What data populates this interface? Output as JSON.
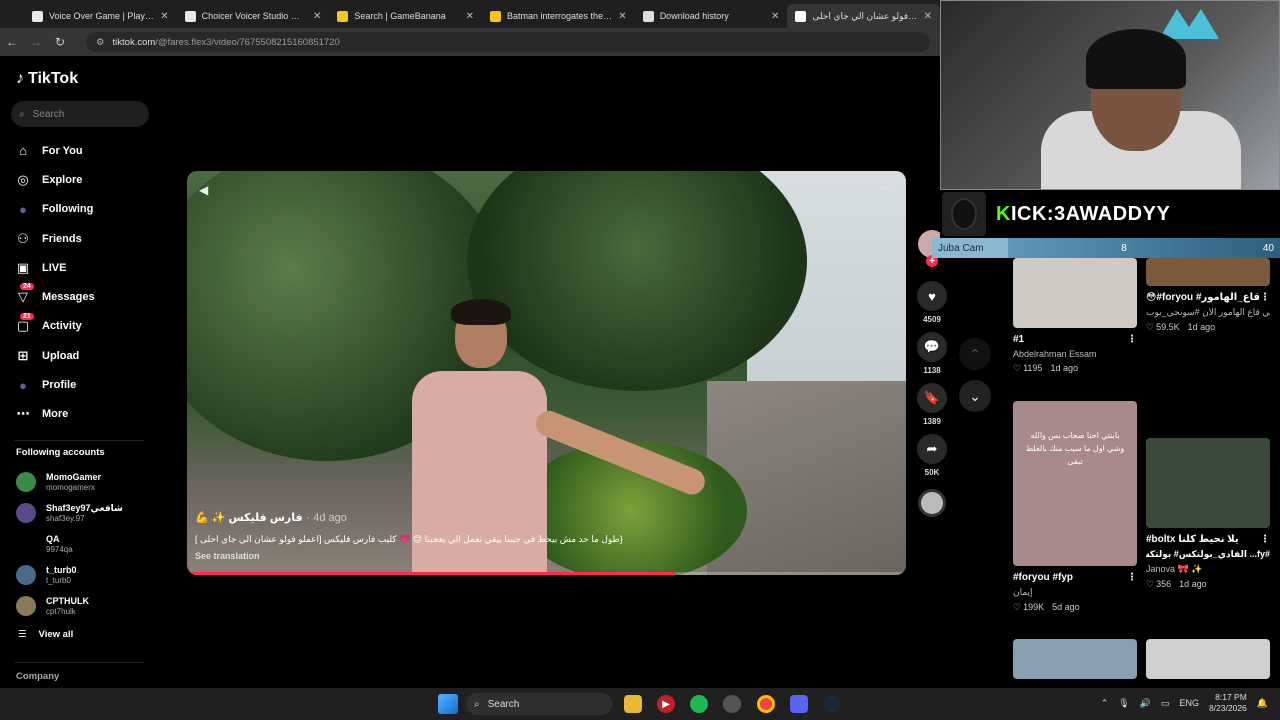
{
  "tabs": [
    {
      "title": "Voice Over Game | Play Choicer",
      "icon": "page-icon",
      "color": "#e8e8e8"
    },
    {
      "title": "Choicer Voicer Studio — Free C",
      "icon": "page-icon",
      "color": "#e8e8e8"
    },
    {
      "title": "Search | GameBanana",
      "icon": "banana-icon",
      "color": "#f5c518"
    },
    {
      "title": "Batman interrogates the Joker -",
      "icon": "banana-icon",
      "color": "#f5c518"
    },
    {
      "title": "Download history",
      "icon": "download-icon",
      "color": "#dddddd"
    },
    {
      "title": "علمو فولو عشان الي جاي احلى |",
      "icon": "tiktok-icon",
      "color": "#ffffff"
    }
  ],
  "tab_close": "✕",
  "address": {
    "host": "tiktok.com",
    "path": "/@fares.flex3/video/7675508215160851720"
  },
  "tiktok": {
    "logo": "TikTok",
    "search_placeholder": "Search",
    "menu": [
      {
        "label": "For You",
        "icon": "home-icon",
        "glyph": "⌂"
      },
      {
        "label": "Explore",
        "icon": "compass-icon",
        "glyph": "◎"
      },
      {
        "label": "Following",
        "icon": "following-avatar-icon",
        "glyph": "●"
      },
      {
        "label": "Friends",
        "icon": "friends-icon",
        "glyph": "⚇"
      },
      {
        "label": "LIVE",
        "icon": "live-icon",
        "glyph": "▣"
      },
      {
        "label": "Messages",
        "icon": "messages-icon",
        "glyph": "▽",
        "badge": "24"
      },
      {
        "label": "Activity",
        "icon": "activity-icon",
        "glyph": "▢",
        "badge": "21"
      },
      {
        "label": "Upload",
        "icon": "upload-icon",
        "glyph": "⊞"
      },
      {
        "label": "Profile",
        "icon": "profile-avatar-icon",
        "glyph": "●"
      },
      {
        "label": "More",
        "icon": "more-icon",
        "glyph": "⋯"
      }
    ],
    "following_title": "Following accounts",
    "following": [
      {
        "name": "MomoGamer",
        "handle": "momogamerx",
        "color": "#3a8a4a"
      },
      {
        "name": "Shaf3ey97شافعي",
        "handle": "shaf3ey.97",
        "color": "#5a4a8a"
      },
      {
        "name": "QA",
        "handle": "9974qa",
        "color": "#000000"
      },
      {
        "name": "t_turb0",
        "handle": "t_turb0",
        "color": "#4a6a8a"
      },
      {
        "name": "CPTHULK",
        "handle": "cpt7hulk",
        "color": "#8a7a5a"
      }
    ],
    "view_all": "View all",
    "company": "Company"
  },
  "video": {
    "author": "فارس فليكس ✨ 💪",
    "age": "· 4d ago",
    "description": "{طول ما حد مش بيحط في جيبنا بيقي نعمل الي يعجبنا 😊 💗 كليب فارس فليكس [اعملو فولو عشان الي جاي احلى ]",
    "see_translation": "See translation",
    "progress": 0.68,
    "likes": "4509",
    "comments": "1138",
    "saves": "1389",
    "shares": "50K"
  },
  "stream": {
    "kick_prefix": "K",
    "kick_label": "ICK:3AWADDYY",
    "bar_left": "Juba Cam",
    "bar_mid": "8",
    "bar_right": "40"
  },
  "cards": [
    {
      "title": "#1",
      "author": "Abdelrahman Essam",
      "likes": "1195",
      "age": "1d ago",
      "thumb": "#cfcac3"
    },
    {
      "title": "😳#foryou #قاع_الهامور",
      "author": "شكاوي اهالي قاع الهامور الان #سونجي_بوب #forupage…",
      "likes": "59.5K",
      "age": "1d ago",
      "thumb": "#7a5a3a"
    },
    {
      "title": "#foryou #fyp",
      "author": "إيمان",
      "likes": "199K",
      "age": "5d ago",
      "thumb": "#a88a8a",
      "overlay": "بابنتي احنا صحاب بس والله وشي اول ما سيب منك بالغلط تبقى"
    },
    {
      "title": "#boltx يلا نحيط كلنا",
      "author": "Janova 🎀 ✨",
      "likes": "356",
      "age": "1d ago",
      "thumb": "#3a4a3a",
      "subtitle": "#fy... الفادي_بولتكس# بولتكس#"
    },
    {
      "title": "",
      "author": "",
      "likes": "",
      "age": "",
      "thumb": "#8aa0b0"
    },
    {
      "title": "",
      "author": "",
      "likes": "",
      "age": "",
      "thumb": "#d0d0d0"
    }
  ],
  "taskbar": {
    "search": "Search",
    "lang": "ENG",
    "time": "8:17 PM",
    "date": "8/23/2026"
  }
}
